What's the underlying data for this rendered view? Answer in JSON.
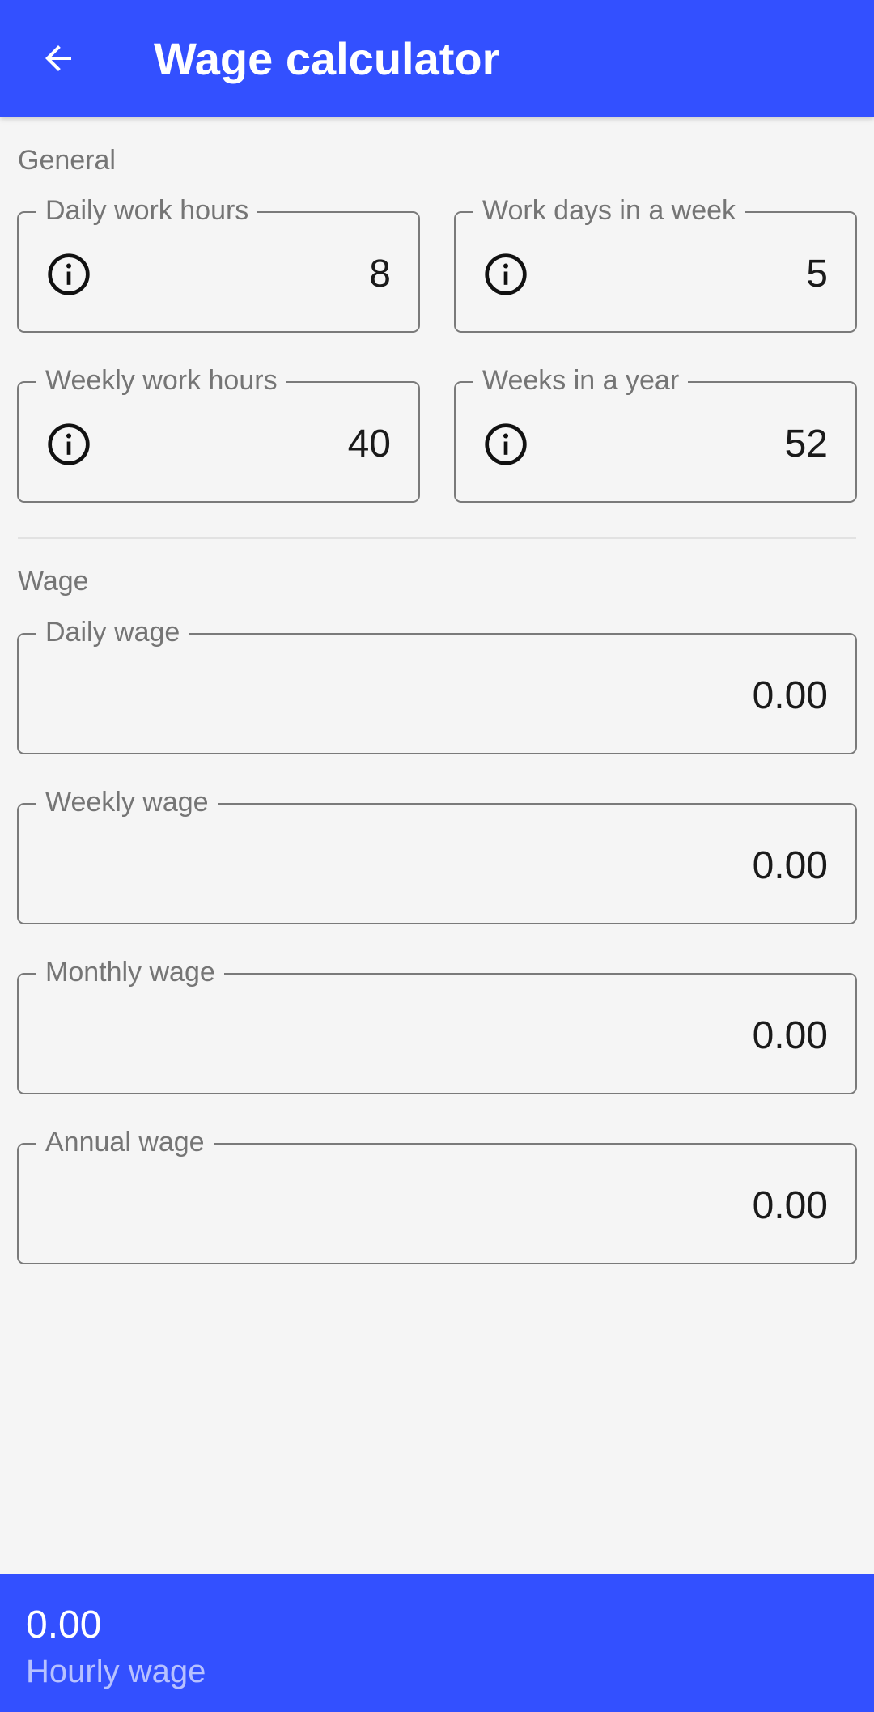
{
  "appbar": {
    "title": "Wage calculator",
    "back_icon": "arrow-left-icon",
    "background": "#3350ff"
  },
  "general": {
    "section_label": "General",
    "fields": [
      {
        "label": "Daily work hours",
        "value": "8",
        "icon": "info-icon"
      },
      {
        "label": "Work days in a week",
        "value": "5",
        "icon": "info-icon"
      },
      {
        "label": "Weekly work hours",
        "value": "40",
        "icon": "info-icon"
      },
      {
        "label": "Weeks in a year",
        "value": "52",
        "icon": "info-icon"
      }
    ]
  },
  "wage": {
    "section_label": "Wage",
    "fields": [
      {
        "label": "Daily wage",
        "value": "0.00"
      },
      {
        "label": "Weekly wage",
        "value": "0.00"
      },
      {
        "label": "Monthly wage",
        "value": "0.00"
      },
      {
        "label": "Annual wage",
        "value": "0.00"
      }
    ]
  },
  "bottom_bar": {
    "value": "0.00",
    "label": "Hourly wage"
  }
}
